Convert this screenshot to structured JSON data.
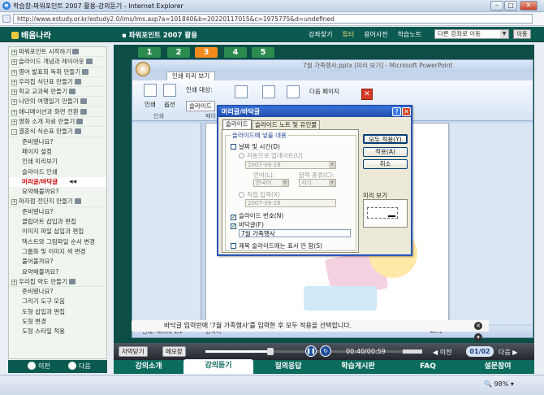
{
  "browser": {
    "title": "학습창-파워포인트 2007 활용-강의듣기 - Internet Explorer",
    "url": "http://www.estudy.or.kr/estudy2.0/lms/lms.asp?a=101840&b=20220117015&c=1975775&d=undefined",
    "zoom": "98%"
  },
  "header": {
    "brand": "배움나라",
    "course": "파워포인트 2007 활용",
    "links": [
      "강좌찾기",
      "튜터",
      "용어사전",
      "학습노트"
    ],
    "select_value": "다른 강좌로 이동",
    "go_label": "이동"
  },
  "sidebar": {
    "items": [
      {
        "label": "파워포인트 시작하기"
      },
      {
        "label": "슬라이드 개념과 레이아웃"
      },
      {
        "label": "영어 발표회 독취 만들기"
      },
      {
        "label": "우리집 식단표 만들기"
      },
      {
        "label": "학교 교과목 만들기"
      },
      {
        "label": "나만의 여행일기 만들기"
      },
      {
        "label": "애니메이션과 화면 전환"
      },
      {
        "label": "영화 소개 자료 만들기"
      },
      {
        "label": "결혼식 식순표 만들기"
      }
    ],
    "sub1": [
      "준비됐나요?",
      "페이지 설정",
      "인쇄 미리보기",
      "슬라이드 인쇄",
      "머리글/바닥글",
      "요약해볼까요?"
    ],
    "item10": "파자점 전단지 만들기",
    "sub2": [
      "준비됐나요?",
      "클립아트 삽입과 편집",
      "이미지 파일 삽입과 편집",
      "텍스트와 그림파일 순서 변경",
      "그룹화 및 이미지 색 변경",
      "풀어볼까요?",
      "요약해볼까요?"
    ],
    "item11": "우리집 약도 만들기",
    "sub3": [
      "준비됐나요?",
      "그리기 도구 모음",
      "도형 삽입과 편집",
      "도형 변경",
      "도형 스타일 적용"
    ],
    "prev": "이전",
    "next": "다음"
  },
  "pages": [
    "1",
    "2",
    "3",
    "4",
    "5"
  ],
  "ppt": {
    "title": "7월 가족행사.pptx [미리 보기] - Microsoft PowerPoint",
    "tab": "인쇄 미리 보기",
    "btn_print": "인쇄",
    "btn_options": "옵션",
    "group_print": "인쇄",
    "print_target_label": "인쇄 대상:",
    "print_target_value": "슬라이드",
    "next_page": "다음 페이지",
    "group_page": "페이",
    "status_slide": "인쇄: 페이지 1/2",
    "status_lang": "한국어",
    "status_zoom": "46%"
  },
  "dialog": {
    "title": "머리글/바닥글",
    "tabs": [
      "슬라이드",
      "슬라이드 노트 및 유인물"
    ],
    "group_label": "슬라이드에 넣을 내용",
    "date_time": "날짜 및 시간(D)",
    "auto_update": "자동으로 업데이트(U)",
    "auto_date": "2007-09-28",
    "lang_label": "언어(L):",
    "calendar_label": "달력 종류(C):",
    "lang_value": "한국어",
    "calendar_value": "서기",
    "fixed": "직접 입력(X)",
    "fixed_date": "2007-09-28",
    "slide_number": "슬라이드 번호(N)",
    "footer": "바닥글(F)",
    "footer_text": "7월 가족행사",
    "title_slide": "제목 슬라이드에는 표시 안 함(S)",
    "apply_all": "모두 적용(Y)",
    "apply": "적용(A)",
    "cancel": "취소",
    "preview": "미리 보기"
  },
  "caption": "바닥글 입력란에 '7월 가족행사'를 입력한 후 모두 적용을 선택합니다.",
  "player": {
    "subtitle_off": "자막닫기",
    "memo": "메모장",
    "time": "00:40/00:59",
    "prev": "이전",
    "page": "01/02",
    "next": "다음"
  },
  "bottom_tabs": [
    "강의소개",
    "강의듣기",
    "질의응답",
    "학습게시판",
    "FAQ",
    "설문참여"
  ]
}
